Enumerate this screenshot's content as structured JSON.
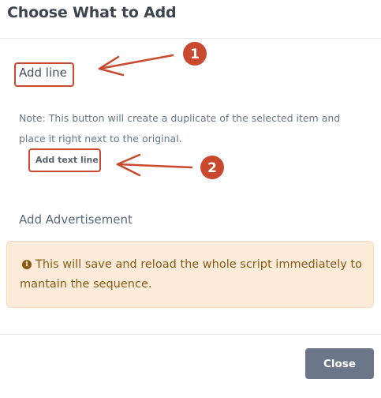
{
  "modal": {
    "title": "Choose What to Add"
  },
  "options": {
    "add_line_label": "Add line",
    "note": "Note: This button will create a duplicate of the selected item and place it right next to the original.",
    "add_text_line_label": "Add text line",
    "add_advertisement_label": "Add Advertisement"
  },
  "warning": {
    "icon": "info-icon",
    "text": "This will save and reload the whole script immediately to mantain the sequence."
  },
  "footer": {
    "close_label": "Close"
  },
  "annotations": {
    "color": "#c8492e",
    "markers": [
      "1",
      "2"
    ]
  },
  "colors": {
    "warning_background": "#fcebd9",
    "warning_text": "#8a5a15",
    "close_button": "#6c7689"
  }
}
